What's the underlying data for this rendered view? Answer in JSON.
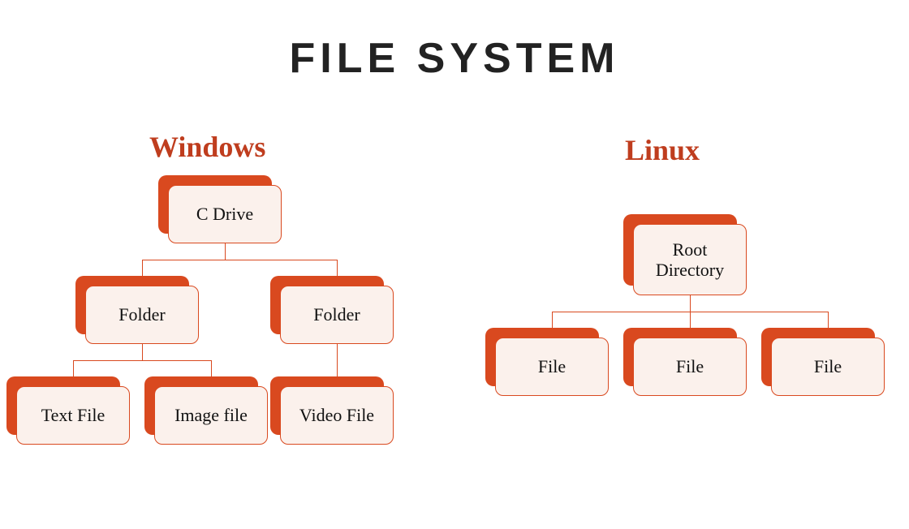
{
  "title": "FILE SYSTEM",
  "windows": {
    "label": "Windows",
    "root": "C Drive",
    "folder1": "Folder",
    "folder2": "Folder",
    "leaf1": "Text File",
    "leaf2": "Image file",
    "leaf3": "Video File"
  },
  "linux": {
    "label": "Linux",
    "root": "Root Directory",
    "file1": "File",
    "file2": "File",
    "file3": "File"
  }
}
